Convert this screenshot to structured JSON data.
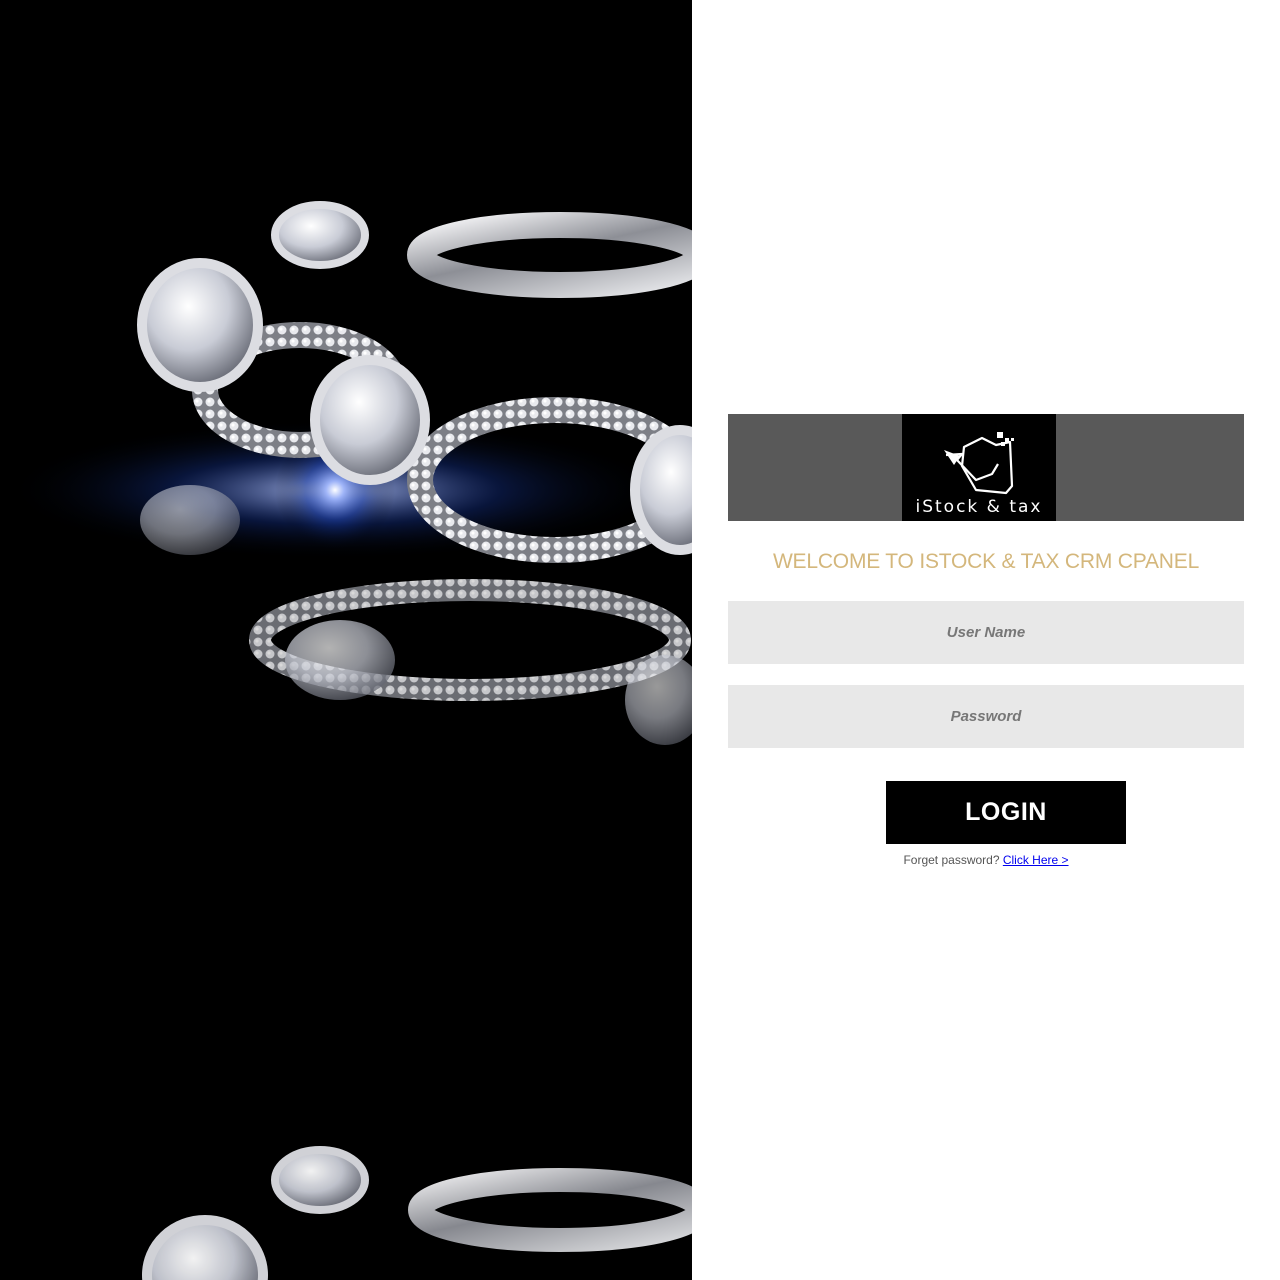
{
  "hero": {
    "image": "diamond-bracelet-photo"
  },
  "brand": {
    "logo_text": "iStock & tax"
  },
  "login": {
    "welcome": "WELCOME TO ISTOCK & TAX CRM CPANEL",
    "username_placeholder": "User Name",
    "username_value": "",
    "password_placeholder": "Password",
    "password_value": "",
    "submit_label": "LOGIN",
    "forgot_prefix": "Forget password?",
    "forgot_link": "Click Here >"
  },
  "colors": {
    "welcome_text": "#d4b77c",
    "logo_bar": "#595959",
    "input_bg": "#e8e8e8",
    "button_bg": "#000000",
    "link": "#0000ee"
  }
}
